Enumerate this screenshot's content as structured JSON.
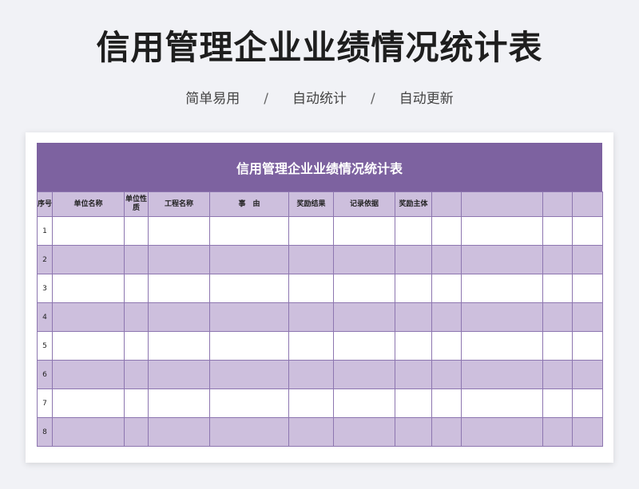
{
  "title": "信用管理企业业绩情况统计表",
  "tags": [
    "简单易用",
    "自动统计",
    "自动更新"
  ],
  "tag_separator": "/",
  "sheet": {
    "header": "信用管理企业业绩情况统计表",
    "columns": [
      "序号",
      "单位名称",
      "单位性质",
      "工程名称",
      "事　由",
      "奖励结果",
      "记录依据",
      "奖励主体",
      "",
      "",
      "",
      ""
    ],
    "rows": [
      "1",
      "2",
      "3",
      "4",
      "5",
      "6",
      "7",
      "8"
    ]
  },
  "colors": {
    "accent": "#7d62a0",
    "row_alt": "#cdbfdd",
    "grid_line": "#8d76b0",
    "background": "#f1f2f6"
  }
}
